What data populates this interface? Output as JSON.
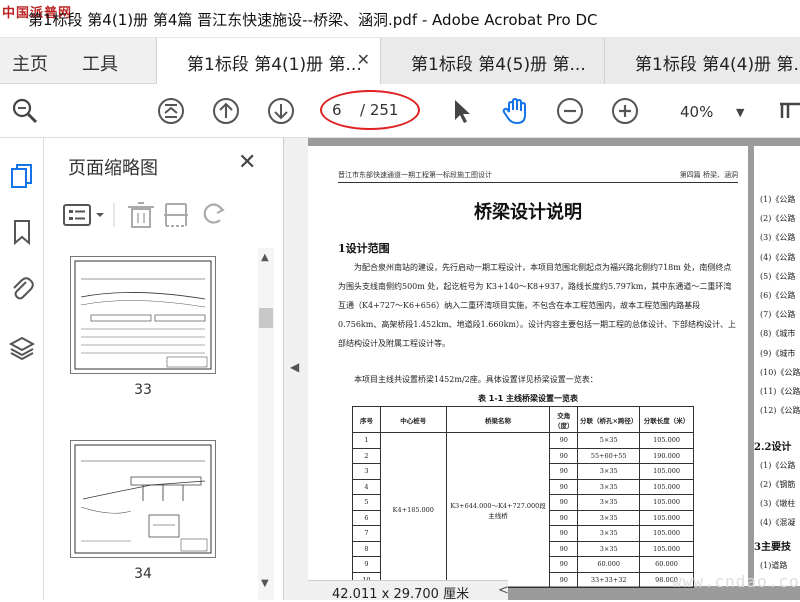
{
  "window": {
    "title": "第1标段 第4(1)册 第4篇 晋江东快速施设--桥梁、涵洞.pdf - Adobe Acrobat Pro DC",
    "watermark_tl": "中国派普网"
  },
  "menu_tabs": [
    "主页",
    "工具"
  ],
  "doc_tabs": [
    {
      "label": "第1标段 第4(1)册 第...",
      "active": true
    },
    {
      "label": "第1标段 第4(5)册 第...",
      "active": false
    },
    {
      "label": "第1标段 第4(4)册 第...",
      "active": false
    }
  ],
  "toolbar": {
    "page_current": "6",
    "page_total": "/ 251",
    "zoom": "40%"
  },
  "panel": {
    "title": "页面缩略图",
    "thumbs": [
      "33",
      "34"
    ]
  },
  "page": {
    "header_left": "晋江市东部快速通道一期工程第一标段施工图设计",
    "header_right": "第四篇  桥梁、涵洞",
    "title": "桥梁设计说明",
    "sec1": "1设计范围",
    "para1": "为配合泉州南站的建设，先行启动一期工程设计，本项目范围北侧起点为福兴路北侧约718m 处，南侧终点为围头支线南侧约500m 处，起讫桩号为 K3+140～K8+937，路线长度约5.797km，其中东通道～二重环湾互通（K4+727～K6+656）纳入二重环湾项目实施，不包含在本工程范围内，故本工程范围内路基段0.756km、高架桥段1.452km、地道段1.660km）。设计内容主要包括一期工程的总体设计、下部结构设计、上部结构设计及附属工程设计等。",
    "para2": "本项目主线共设置桥梁1452m/2座。具体设置详见桥梁设置一览表：",
    "table_caption": "表 1-1 主线桥梁设置一览表",
    "table_headers": [
      "序号",
      "中心桩号",
      "桥梁名称",
      "交角（度）",
      "分联（桥孔×跨径）",
      "分联长度（米）"
    ],
    "table_rows": [
      [
        "1",
        "90",
        "5×35",
        "105.000"
      ],
      [
        "2",
        "90",
        "55+60+55",
        "190.000"
      ],
      [
        "3",
        "90",
        "3×35",
        "105.000"
      ],
      [
        "4",
        "90",
        "3×35",
        "105.000"
      ],
      [
        "5",
        "90",
        "3×35",
        "105.000"
      ],
      [
        "6",
        "90",
        "3×35",
        "105.000"
      ],
      [
        "7",
        "90",
        "3×35",
        "105.000"
      ],
      [
        "8",
        "90",
        "3×35",
        "105.000"
      ],
      [
        "9",
        "90",
        "60.000",
        "60.000"
      ],
      [
        "10",
        "90",
        "33+33+32",
        "98.000"
      ]
    ],
    "center_station": "K4+185.000",
    "bridge_name": "K3+644.000～K4+727.000段主线桥"
  },
  "page2": {
    "items": [
      "(1)《公路",
      "(2)《公路",
      "(3)《公路",
      "(4)《公路",
      "(5)《公路",
      "(6)《公路",
      "(7)《公路",
      "(8)《城市",
      "(9)《城市",
      "(10)《公路",
      "(11)《公路",
      "(12)《公路"
    ],
    "sec22": "2.2设计",
    "items2": [
      "(1)《公路",
      "(2)《钢筋",
      "(3)《墩柱",
      "(4)《混凝"
    ],
    "sec3": "3主要技",
    "tail": "(1)道路"
  },
  "status": {
    "dimensions": "42.011 x 29.700 厘米",
    "watermark_br": "www.cndao.com"
  },
  "colors": {
    "accent_blue": "#1473e6",
    "annotation_red": "#e02020"
  }
}
